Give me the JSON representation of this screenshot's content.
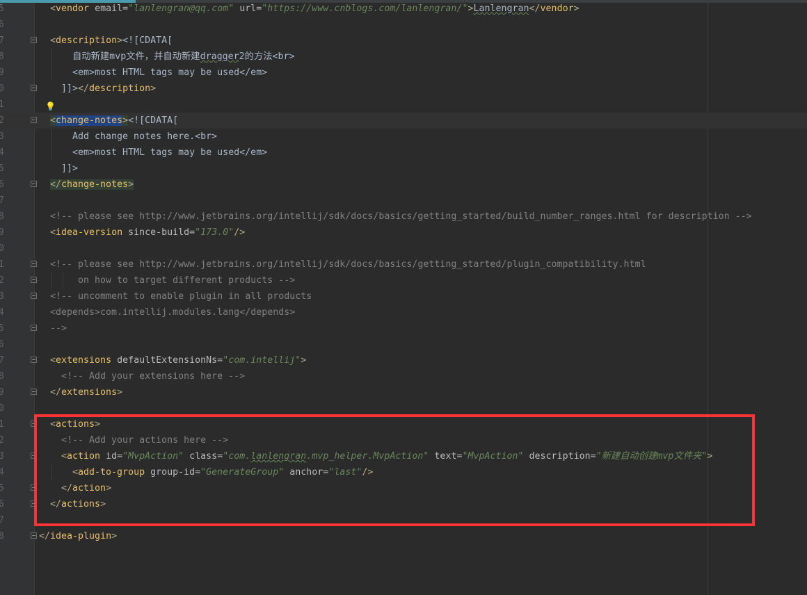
{
  "editor": {
    "colors": {
      "background": "#2b2b2b",
      "tag": "#e8bf6a",
      "attribute": "#bababa",
      "value": "#6a8759",
      "comment": "#808080",
      "text": "#a9b7c6",
      "highlight_box": "#ff3333"
    },
    "current_line_index": 7,
    "lines": [
      {
        "n": "5",
        "indent": 2,
        "tokens": [
          [
            "br",
            "<"
          ],
          [
            "tag",
            "vendor"
          ],
          [
            "attr",
            " email="
          ],
          [
            "val",
            "\"lanlengran@qq.com\""
          ],
          [
            "attr",
            " url="
          ],
          [
            "val",
            "\"https://www.cnblogs.com/lanlengran/\""
          ],
          [
            "br",
            ">"
          ],
          [
            "text typo",
            "Lanlengran"
          ],
          [
            "br",
            "</"
          ],
          [
            "tag",
            "vendor"
          ],
          [
            "br",
            ">"
          ]
        ]
      },
      {
        "n": "6",
        "indent": 0,
        "tokens": []
      },
      {
        "n": "7",
        "indent": 2,
        "fold": true,
        "tokens": [
          [
            "br",
            "<"
          ],
          [
            "tag",
            "description"
          ],
          [
            "br",
            ">"
          ],
          [
            "cdata",
            "<![CDATA["
          ]
        ]
      },
      {
        "n": "8",
        "indent": 6,
        "tokens": [
          [
            "text",
            "自动新建mvp文件，并自动新建"
          ],
          [
            "text typo",
            "dragger"
          ],
          [
            "text",
            "2的方法"
          ],
          [
            "cdata",
            "<br>"
          ]
        ]
      },
      {
        "n": "9",
        "indent": 6,
        "tokens": [
          [
            "cdata",
            "<em>"
          ],
          [
            "text",
            "most HTML tags may be used"
          ],
          [
            "cdata",
            "</em>"
          ]
        ]
      },
      {
        "n": "0",
        "indent": 4,
        "fold": true,
        "tokens": [
          [
            "cdata",
            "]]>"
          ],
          [
            "br",
            "</"
          ],
          [
            "tag",
            "description"
          ],
          [
            "br",
            ">"
          ]
        ]
      },
      {
        "n": "1",
        "indent": 0,
        "bulb": true,
        "tokens": []
      },
      {
        "n": "2",
        "indent": 2,
        "fold": true,
        "tokens": [
          [
            "br match",
            "<"
          ],
          [
            "tag sel",
            "change-notes"
          ],
          [
            "br match",
            ">"
          ],
          [
            "cdata",
            "<![CDATA["
          ]
        ]
      },
      {
        "n": "3",
        "indent": 6,
        "tokens": [
          [
            "text",
            "Add change notes here."
          ],
          [
            "cdata",
            "<br>"
          ]
        ]
      },
      {
        "n": "4",
        "indent": 6,
        "tokens": [
          [
            "cdata",
            "<em>"
          ],
          [
            "text",
            "most HTML tags may be used"
          ],
          [
            "cdata",
            "</em>"
          ]
        ]
      },
      {
        "n": "5",
        "indent": 4,
        "tokens": [
          [
            "cdata",
            "]]>"
          ]
        ]
      },
      {
        "n": "6",
        "indent": 2,
        "fold": true,
        "tokens": [
          [
            "br match",
            "</"
          ],
          [
            "tag match",
            "change-notes"
          ],
          [
            "br match",
            ">"
          ]
        ]
      },
      {
        "n": "7",
        "indent": 0,
        "tokens": []
      },
      {
        "n": "8",
        "indent": 2,
        "tokens": [
          [
            "com",
            "<!-- please see http://www.jetbrains.org/intellij/sdk/docs/basics/getting_started/build_number_ranges.html for description -->"
          ]
        ]
      },
      {
        "n": "9",
        "indent": 2,
        "tokens": [
          [
            "br",
            "<"
          ],
          [
            "tag",
            "idea-version"
          ],
          [
            "attr",
            " since-build="
          ],
          [
            "val",
            "\"173.0\""
          ],
          [
            "br",
            "/>"
          ]
        ]
      },
      {
        "n": "0",
        "indent": 0,
        "tokens": []
      },
      {
        "n": "1",
        "indent": 2,
        "fold": true,
        "tokens": [
          [
            "com",
            "<!-- please see http://www.jetbrains.org/intellij/sdk/docs/basics/getting_started/plugin_compatibility.html"
          ]
        ]
      },
      {
        "n": "2",
        "indent": 7,
        "fold": true,
        "tokens": [
          [
            "com",
            "on how to target different products -->"
          ]
        ]
      },
      {
        "n": "3",
        "indent": 2,
        "fold": true,
        "tokens": [
          [
            "com",
            "<!-- uncomment to enable plugin in all products"
          ]
        ]
      },
      {
        "n": "4",
        "indent": 2,
        "tokens": [
          [
            "com",
            "<depends>com.intellij.modules.lang</depends>"
          ]
        ]
      },
      {
        "n": "5",
        "indent": 2,
        "fold": true,
        "tokens": [
          [
            "com",
            "-->"
          ]
        ]
      },
      {
        "n": "6",
        "indent": 0,
        "tokens": []
      },
      {
        "n": "7",
        "indent": 2,
        "fold": true,
        "tokens": [
          [
            "br",
            "<"
          ],
          [
            "tag",
            "extensions"
          ],
          [
            "attr",
            " defaultExtensionNs="
          ],
          [
            "val",
            "\"com.intellij\""
          ],
          [
            "br",
            ">"
          ]
        ]
      },
      {
        "n": "8",
        "indent": 4,
        "tokens": [
          [
            "com",
            "<!-- Add your extensions here -->"
          ]
        ]
      },
      {
        "n": "9",
        "indent": 2,
        "fold": true,
        "tokens": [
          [
            "br",
            "</"
          ],
          [
            "tag",
            "extensions"
          ],
          [
            "br",
            ">"
          ]
        ]
      },
      {
        "n": "0",
        "indent": 0,
        "tokens": []
      },
      {
        "n": "1",
        "indent": 2,
        "fold": true,
        "tokens": [
          [
            "br",
            "<"
          ],
          [
            "tag",
            "actions"
          ],
          [
            "br",
            ">"
          ]
        ]
      },
      {
        "n": "2",
        "indent": 4,
        "tokens": [
          [
            "com",
            "<!-- Add your actions here -->"
          ]
        ]
      },
      {
        "n": "3",
        "indent": 4,
        "fold": true,
        "tokens": [
          [
            "br",
            "<"
          ],
          [
            "tag",
            "action"
          ],
          [
            "attr",
            " id="
          ],
          [
            "val",
            "\"MvpAction\""
          ],
          [
            "attr",
            " class="
          ],
          [
            "val",
            "\"com."
          ],
          [
            "val typo",
            "lanlengran"
          ],
          [
            "val",
            ".mvp_helper.MvpAction\""
          ],
          [
            "attr",
            " text="
          ],
          [
            "val",
            "\"MvpAction\""
          ],
          [
            "attr",
            " description="
          ],
          [
            "val",
            "\"新建自动创建mvp文件夹\""
          ],
          [
            "br",
            ">"
          ]
        ]
      },
      {
        "n": "4",
        "indent": 6,
        "tokens": [
          [
            "br",
            "<"
          ],
          [
            "tag",
            "add-to-group"
          ],
          [
            "attr",
            " group-id="
          ],
          [
            "val",
            "\"GenerateGroup\""
          ],
          [
            "attr",
            " anchor="
          ],
          [
            "val",
            "\"last\""
          ],
          [
            "br",
            "/>"
          ]
        ]
      },
      {
        "n": "5",
        "indent": 4,
        "fold": true,
        "tokens": [
          [
            "br",
            "</"
          ],
          [
            "tag",
            "action"
          ],
          [
            "br",
            ">"
          ]
        ]
      },
      {
        "n": "6",
        "indent": 2,
        "fold": true,
        "tokens": [
          [
            "br",
            "</"
          ],
          [
            "tag",
            "actions"
          ],
          [
            "br",
            ">"
          ]
        ]
      },
      {
        "n": "7",
        "indent": 0,
        "tokens": []
      },
      {
        "n": "8",
        "indent": 0,
        "fold": true,
        "tokens": [
          [
            "br",
            "</"
          ],
          [
            "tag",
            "idea-plugin"
          ],
          [
            "br",
            ">"
          ]
        ]
      }
    ]
  }
}
